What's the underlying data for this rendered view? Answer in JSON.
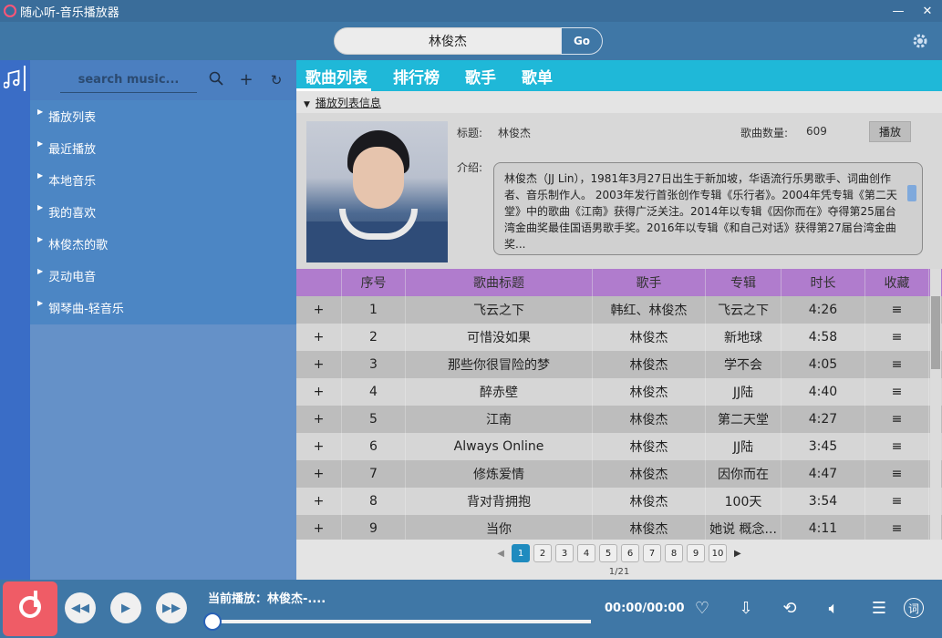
{
  "window": {
    "title": "随心听-音乐播放器",
    "minimize_icon": "minimize-icon",
    "close_icon": "close-icon"
  },
  "top_search": {
    "value": "林俊杰",
    "go_label": "Go"
  },
  "sidebar": {
    "search_placeholder": "search music...",
    "items": [
      {
        "label": "播放列表"
      },
      {
        "label": "最近播放"
      },
      {
        "label": "本地音乐"
      },
      {
        "label": "我的喜欢"
      },
      {
        "label": "林俊杰的歌"
      },
      {
        "label": "灵动电音"
      },
      {
        "label": "钢琴曲-轻音乐"
      }
    ]
  },
  "tabs": [
    {
      "label": "歌曲列表",
      "active": true
    },
    {
      "label": "排行榜"
    },
    {
      "label": "歌手"
    },
    {
      "label": "歌单"
    }
  ],
  "info": {
    "toggle_label": "播放列表信息",
    "title_label": "标题:",
    "title_value": "林俊杰",
    "count_label": "歌曲数量:",
    "count_value": "609",
    "play_label": "播放",
    "intro_label": "介绍:",
    "intro_text": "林俊杰（JJ Lin），1981年3月27日出生于新加坡，华语流行乐男歌手、词曲创作者、音乐制作人。 2003年发行首张创作专辑《乐行者》。2004年凭专辑《第二天堂》中的歌曲《江南》获得广泛关注。2014年以专辑《因你而在》夺得第25届台湾金曲奖最佳国语男歌手奖。2016年以专辑《和自己对话》获得第27届台湾金曲奖..."
  },
  "table": {
    "headers": [
      "",
      "序号",
      "歌曲标题",
      "歌手",
      "专辑",
      "时长",
      "收藏"
    ],
    "rows": [
      {
        "add": "+",
        "no": "1",
        "title": "飞云之下",
        "artist": "韩红、林俊杰",
        "album": "飞云之下",
        "duration": "4:26",
        "fav": "≡"
      },
      {
        "add": "+",
        "no": "2",
        "title": "可惜没如果",
        "artist": "林俊杰",
        "album": "新地球",
        "duration": "4:58",
        "fav": "≡"
      },
      {
        "add": "+",
        "no": "3",
        "title": "那些你很冒险的梦",
        "artist": "林俊杰",
        "album": "学不会",
        "duration": "4:05",
        "fav": "≡"
      },
      {
        "add": "+",
        "no": "4",
        "title": "醉赤壁",
        "artist": "林俊杰",
        "album": "JJ陆",
        "duration": "4:40",
        "fav": "≡"
      },
      {
        "add": "+",
        "no": "5",
        "title": "江南",
        "artist": "林俊杰",
        "album": "第二天堂",
        "duration": "4:27",
        "fav": "≡"
      },
      {
        "add": "+",
        "no": "6",
        "title": "Always Online",
        "artist": "林俊杰",
        "album": "JJ陆",
        "duration": "3:45",
        "fav": "≡"
      },
      {
        "add": "+",
        "no": "7",
        "title": "修炼爱情",
        "artist": "林俊杰",
        "album": "因你而在",
        "duration": "4:47",
        "fav": "≡"
      },
      {
        "add": "+",
        "no": "8",
        "title": "背对背拥抱",
        "artist": "林俊杰",
        "album": "100天",
        "duration": "3:54",
        "fav": "≡"
      },
      {
        "add": "+",
        "no": "9",
        "title": "当你",
        "artist": "林俊杰",
        "album": "她说 概念...",
        "duration": "4:11",
        "fav": "≡"
      }
    ]
  },
  "pager": {
    "pages": [
      "1",
      "2",
      "3",
      "4",
      "5",
      "6",
      "7",
      "8",
      "9",
      "10"
    ],
    "current": "1",
    "info": "1/21"
  },
  "player": {
    "now_playing": "当前播放：林俊杰-....",
    "time": "00:00/00:00",
    "progress": 0
  }
}
